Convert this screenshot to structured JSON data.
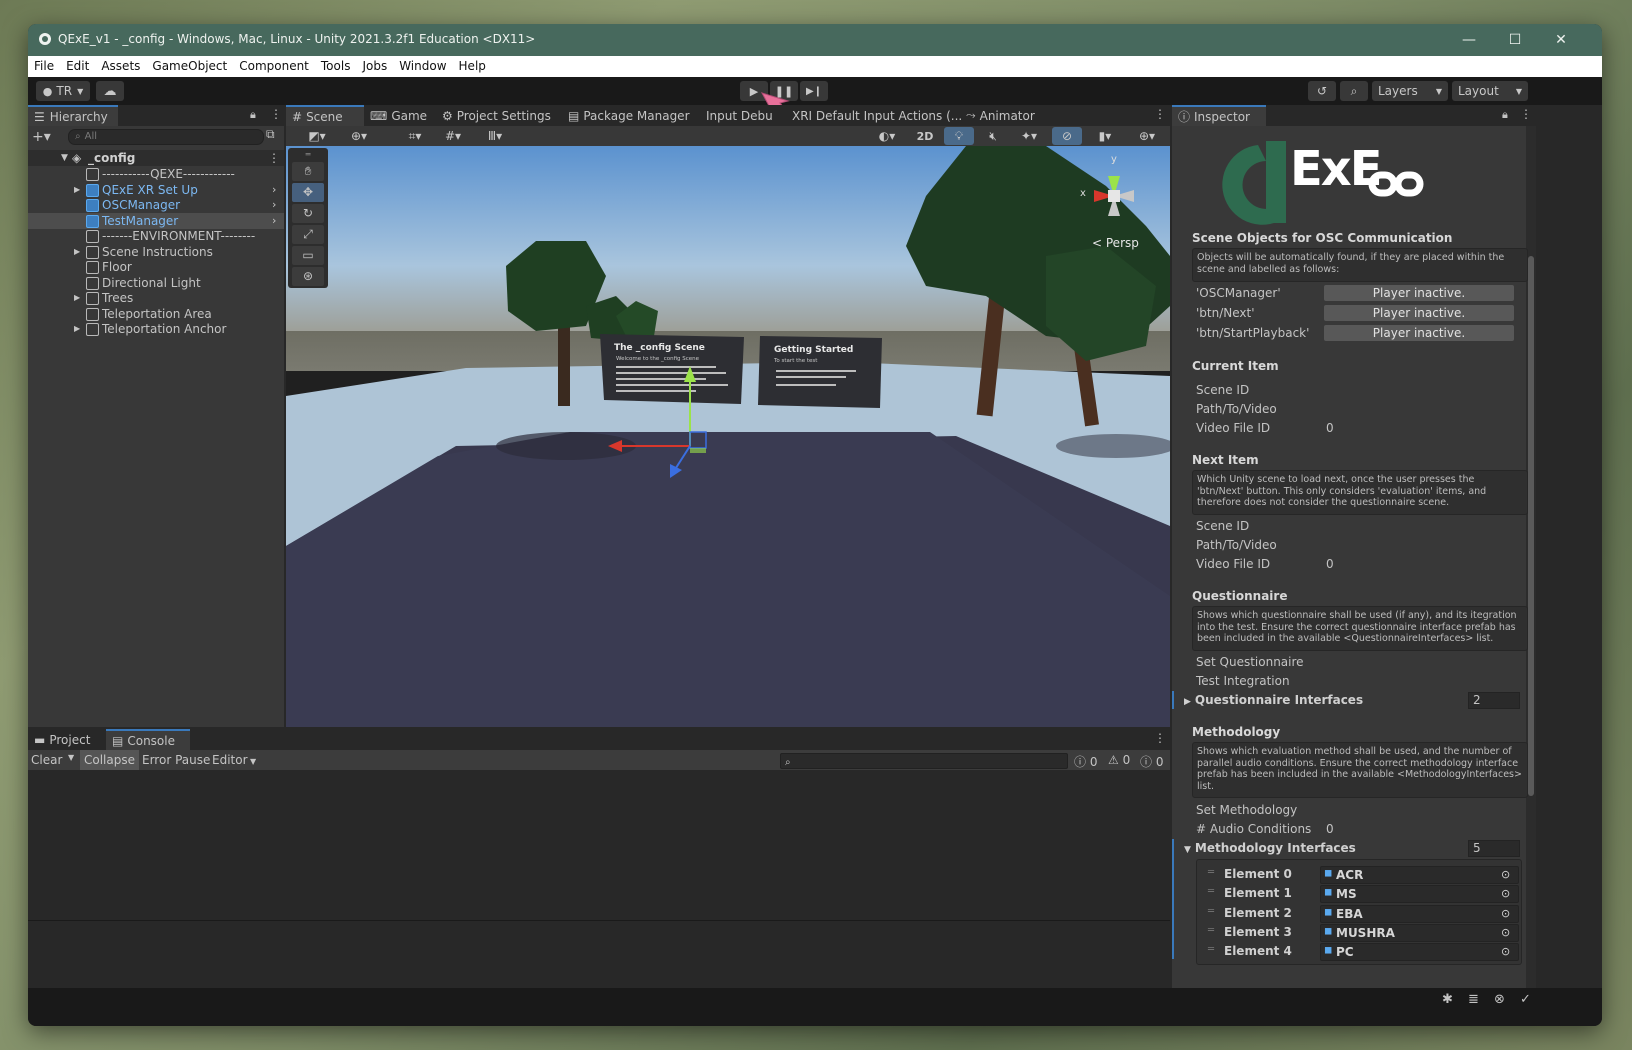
{
  "window": {
    "title": "QExE_v1 - _config - Windows, Mac, Linux - Unity 2021.3.2f1 Education <DX11>",
    "controls": {
      "minimize": "—",
      "maximize": "☐",
      "close": "✕"
    }
  },
  "menu": [
    "File",
    "Edit",
    "Assets",
    "GameObject",
    "Component",
    "Tools",
    "Jobs",
    "Window",
    "Help"
  ],
  "toolbar": {
    "account": "TR",
    "layers": "Layers",
    "layout": "Layout"
  },
  "hierarchy": {
    "tab": "Hierarchy",
    "search_placeholder": "All",
    "scene": "_config",
    "items": [
      {
        "label": "-----------QEXE------------",
        "blue": false,
        "expand": false,
        "arrow": false,
        "selected": false
      },
      {
        "label": "QExE XR Set Up",
        "blue": true,
        "expand": true,
        "arrow": true,
        "selected": false
      },
      {
        "label": "OSCManager",
        "blue": true,
        "expand": false,
        "arrow": true,
        "selected": false
      },
      {
        "label": "TestManager",
        "blue": true,
        "expand": false,
        "arrow": true,
        "selected": true
      },
      {
        "label": "-------ENVIRONMENT--------",
        "blue": false,
        "expand": false,
        "arrow": false,
        "selected": false
      },
      {
        "label": "Scene Instructions",
        "blue": false,
        "expand": true,
        "arrow": false,
        "selected": false
      },
      {
        "label": "Floor",
        "blue": false,
        "expand": false,
        "arrow": false,
        "selected": false
      },
      {
        "label": "Directional Light",
        "blue": false,
        "expand": false,
        "arrow": false,
        "selected": false
      },
      {
        "label": "Trees",
        "blue": false,
        "expand": true,
        "arrow": false,
        "selected": false
      },
      {
        "label": "Teleportation Area",
        "blue": false,
        "expand": false,
        "arrow": false,
        "selected": false
      },
      {
        "label": "Teleportation Anchor",
        "blue": false,
        "expand": true,
        "arrow": false,
        "selected": false
      }
    ]
  },
  "center_tabs": [
    "Scene",
    "Game",
    "Project Settings",
    "Package Manager",
    "Input Debu",
    "XRI Default Input Actions (...",
    "Animator"
  ],
  "scene_view": {
    "mode_2d": "2D",
    "persp": "Persp",
    "axis_x": "x",
    "axis_y": "y",
    "sign1_title": "The _config Scene",
    "sign2_title": "Getting Started",
    "sign1_body": "Welcome to the _config Scene",
    "sign2_body": "To start the test"
  },
  "bottom": {
    "tabs": [
      "Project",
      "Console"
    ],
    "buttons": [
      "Clear",
      "Collapse",
      "Error Pause",
      "Editor"
    ],
    "counts": {
      "log": "0",
      "warn": "0",
      "err": "0"
    }
  },
  "inspector": {
    "tab": "Inspector",
    "logo_text": "ExE",
    "osc": {
      "header": "Scene Objects for OSC Communication",
      "note": "Objects will be automatically found, if they are placed within the scene and labelled as follows:",
      "rows": [
        {
          "label": "'OSCManager'",
          "value": "Player inactive."
        },
        {
          "label": "'btn/Next'",
          "value": "Player inactive."
        },
        {
          "label": "'btn/StartPlayback'",
          "value": "Player inactive."
        }
      ]
    },
    "current": {
      "header": "Current Item",
      "scene_id": "Scene ID",
      "path": "Path/To/Video",
      "video_label": "Video File ID",
      "video_value": "0"
    },
    "next": {
      "header": "Next Item",
      "note": "Which Unity scene to load next, once the user presses the 'btn/Next' button. This only considers 'evaluation' items, and therefore does not consider the questionnaire scene.",
      "scene_id": "Scene ID",
      "path": "Path/To/Video",
      "video_label": "Video File ID",
      "video_value": "0"
    },
    "questionnaire": {
      "header": "Questionnaire",
      "note": "Shows which questionnaire shall be used (if any), and its itegration into the test. Ensure the correct questionnaire interface prefab has been included in the available <QuestionnaireInterfaces> list.",
      "set": "Set Questionnaire",
      "integration": "Test Integration",
      "interfaces_label": "Questionnaire Interfaces",
      "interfaces_count": "2"
    },
    "methodology": {
      "header": "Methodology",
      "note": "Shows which evaluation method shall be used, and the number of parallel audio conditions. Ensure the correct methodology interface prefab has been included in the available <MethodologyInterfaces> list.",
      "set": "Set Methodology",
      "audio_label": "# Audio Conditions",
      "audio_value": "0",
      "interfaces_label": "Methodology Interfaces",
      "interfaces_count": "5",
      "elements": [
        {
          "label": "Element 0",
          "value": "ACR"
        },
        {
          "label": "Element 1",
          "value": "MS"
        },
        {
          "label": "Element 2",
          "value": "EBA"
        },
        {
          "label": "Element 3",
          "value": "MUSHRA"
        },
        {
          "label": "Element 4",
          "value": "PC"
        }
      ]
    }
  },
  "colors": {
    "titlebar": "#47695d",
    "accent_blue": "#3a79bb",
    "logo_green": "#2e6b4f",
    "prefab_blue": "#5aa9ef"
  }
}
